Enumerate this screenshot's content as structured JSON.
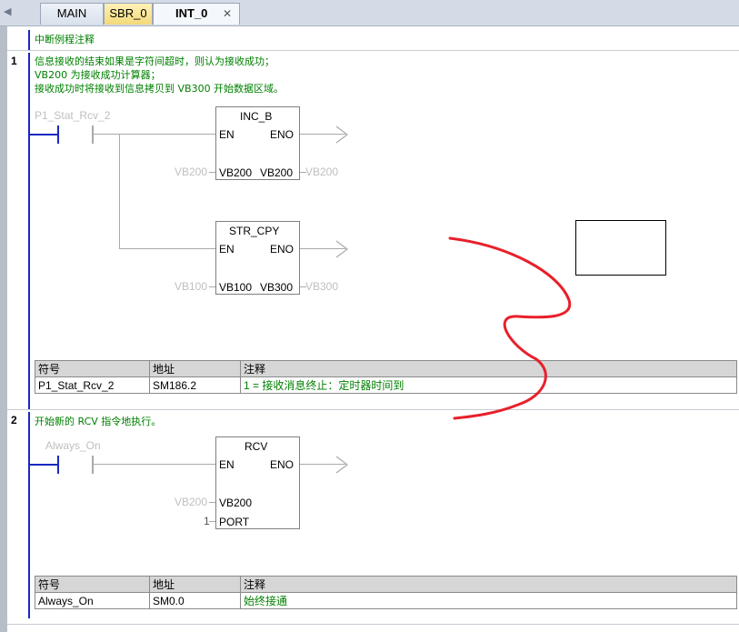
{
  "tabs": {
    "main": "MAIN",
    "sbr": "SBR_0",
    "int": "INT_0",
    "close_glyph": "✕",
    "scroll_glyph": "◀"
  },
  "program_comment": "中断例程注释",
  "networks": [
    {
      "number": "1",
      "comment_lines": [
        "信息接收的结束如果是字符间超时，则认为接收成功；",
        "VB200 为接收成功计算器；",
        "接收成功时将接收到信息拷贝到 VB300 开始数据区域。"
      ],
      "contact": "P1_Stat_Rcv_2",
      "boxes": [
        {
          "title": "INC_B",
          "en": "EN",
          "eno": "ENO",
          "in_pin": "VB200",
          "out_pin": "VB200",
          "in_var": "VB200",
          "out_var": "VB200"
        },
        {
          "title": "STR_CPY",
          "en": "EN",
          "eno": "ENO",
          "in_pin": "VB100",
          "out_pin": "VB300",
          "in_var": "VB100",
          "out_var": "VB300"
        }
      ],
      "symbol_table": {
        "headers": [
          "符号",
          "地址",
          "注释"
        ],
        "rows": [
          [
            "P1_Stat_Rcv_2",
            "SM186.2",
            "1 = 接收消息终止：定时器时间到"
          ]
        ]
      }
    },
    {
      "number": "2",
      "comment_lines": [
        "开始新的 RCV 指令地执行。"
      ],
      "contact": "Always_On",
      "box": {
        "title": "RCV",
        "en": "EN",
        "eno": "ENO",
        "tbl_pin": "VB200",
        "port_pin": "PORT",
        "tbl_var": "VB200",
        "port_var": "1"
      },
      "symbol_table": {
        "headers": [
          "符号",
          "地址",
          "注释"
        ],
        "rows": [
          [
            "Always_On",
            "SM0.0",
            "始终接通"
          ]
        ]
      }
    }
  ],
  "annotation_color": "#e8202a",
  "rail_color": "#1a28c0"
}
